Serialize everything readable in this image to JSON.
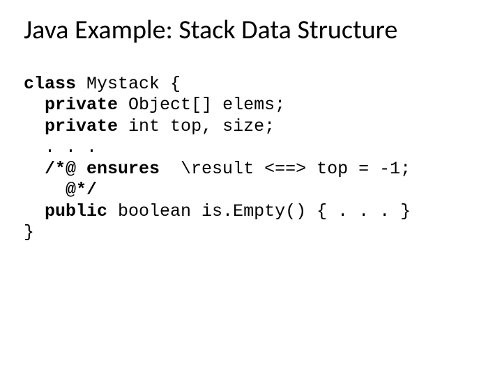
{
  "title": "Java Example: Stack Data Structure",
  "code": {
    "l1_kw": "class",
    "l1_rest": " Mystack {",
    "l2_ind": "  ",
    "l2_kw": "private",
    "l2_rest": " Object[] elems;",
    "l3_ind": "  ",
    "l3_kw": "private",
    "l3_rest": " int top, size;",
    "l4": "  . . .",
    "l5_ind": "  ",
    "l5_kw": "/*@ ensures ",
    "l5_rest": " \\result <==> top = -1;",
    "l6_ind": "    ",
    "l6_kw": "@*/",
    "l7_ind": "  ",
    "l7_kw": "public",
    "l7_rest": " boolean is.Empty() { . . . }",
    "l8": "}"
  }
}
